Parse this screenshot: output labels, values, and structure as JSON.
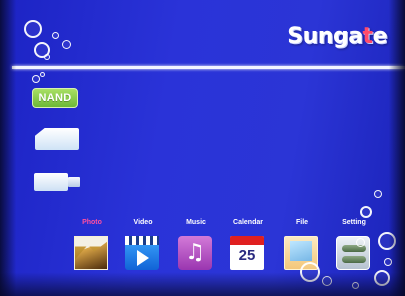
{
  "header": {
    "brand_prefix": "Sunga",
    "brand_accent": "t",
    "brand_suffix": "e",
    "accent_color": "#ff4a6a"
  },
  "storage": {
    "items": [
      {
        "label": "NAND",
        "icon": "nand-chip-icon"
      },
      {
        "label": "",
        "icon": "sd-card-icon"
      },
      {
        "label": "",
        "icon": "usb-drive-icon"
      }
    ]
  },
  "menu": {
    "active_index": 0,
    "active_color": "#ff4fa0",
    "items": [
      {
        "label": "Photo",
        "icon": "photo-icon"
      },
      {
        "label": "Video",
        "icon": "video-icon"
      },
      {
        "label": "Music",
        "icon": "music-icon"
      },
      {
        "label": "Calendar",
        "icon": "calendar-icon",
        "day": "25"
      },
      {
        "label": "File",
        "icon": "file-icon"
      },
      {
        "label": "Setting",
        "icon": "setting-icon"
      }
    ]
  },
  "colors": {
    "background": "#2a33d8",
    "divider": "#f2f4ff"
  }
}
